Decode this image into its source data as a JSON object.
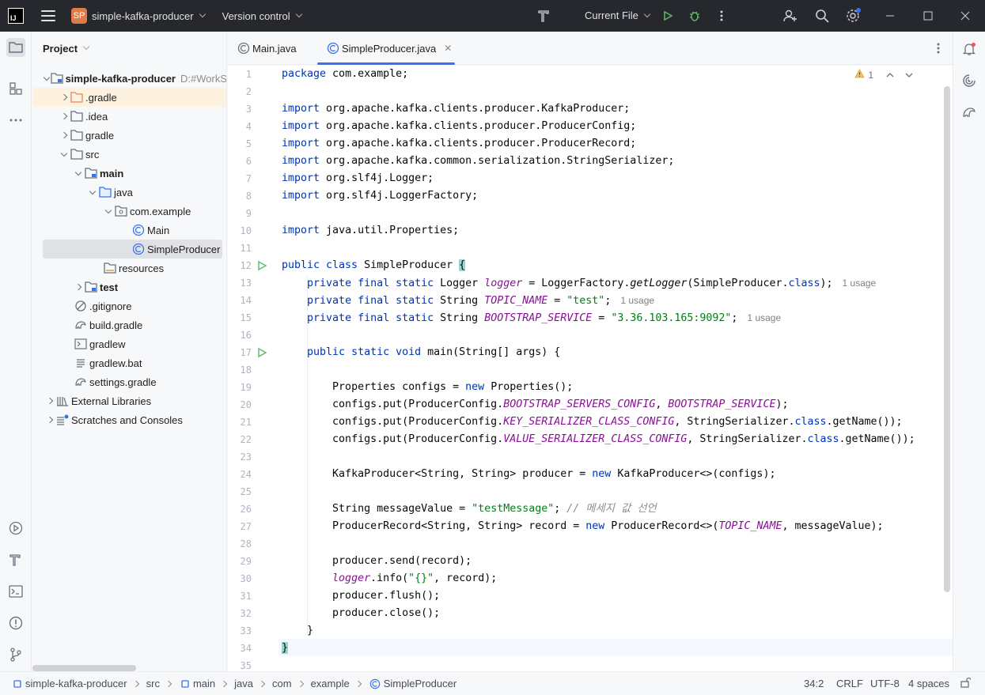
{
  "titlebar": {
    "app_logo": "IJ",
    "project_badge": "SP",
    "project_name": "simple-kafka-producer",
    "vcs_label": "Version control",
    "run_config": "Current File"
  },
  "project_panel": {
    "title": "Project",
    "root_name": "simple-kafka-producer",
    "root_path": "D:#WorkS",
    "items": [
      {
        "label": ".gradle"
      },
      {
        "label": ".idea"
      },
      {
        "label": "gradle"
      },
      {
        "label": "src"
      },
      {
        "label": "main"
      },
      {
        "label": "java"
      },
      {
        "label": "com.example"
      },
      {
        "label": "Main"
      },
      {
        "label": "SimpleProducer"
      },
      {
        "label": "resources"
      },
      {
        "label": "test"
      },
      {
        "label": ".gitignore"
      },
      {
        "label": "build.gradle"
      },
      {
        "label": "gradlew"
      },
      {
        "label": "gradlew.bat"
      },
      {
        "label": "settings.gradle"
      },
      {
        "label": "External Libraries"
      },
      {
        "label": "Scratches and Consoles"
      }
    ]
  },
  "tabs": [
    {
      "label": "Main.java"
    },
    {
      "label": "SimpleProducer.java"
    }
  ],
  "editor": {
    "warnings_count": "1",
    "usage_label": "1 usage",
    "line_numbers": [
      "1",
      "2",
      "3",
      "4",
      "5",
      "6",
      "7",
      "8",
      "9",
      "10",
      "11",
      "12",
      "13",
      "14",
      "15",
      "16",
      "17",
      "18",
      "19",
      "20",
      "21",
      "22",
      "23",
      "24",
      "25",
      "26",
      "27",
      "28",
      "29",
      "30",
      "31",
      "32",
      "33",
      "34",
      "35"
    ],
    "code": {
      "l1_kw": "package",
      "l1_rest": " com.example;",
      "imp": "import",
      "l3": " org.apache.kafka.clients.producer.KafkaProducer;",
      "l4": " org.apache.kafka.clients.producer.ProducerConfig;",
      "l5": " org.apache.kafka.clients.producer.ProducerRecord;",
      "l6": " org.apache.kafka.common.serialization.StringSerializer;",
      "l7": " org.slf4j.Logger;",
      "l8": " org.slf4j.LoggerFactory;",
      "l10": " java.util.Properties;",
      "l12_kw": "public class",
      "l12_name": " SimpleProducer ",
      "l12_brace": "{",
      "pfs": "private final static",
      "l13_type": " Logger ",
      "l13_var": "logger",
      "l13_mid": " = LoggerFactory.",
      "l13_method": "getLogger",
      "l13_arg": "(SimpleProducer.",
      "l13_class": "class",
      "l13_end": ");",
      "l14_type": " String ",
      "l14_var": "TOPIC_NAME",
      "l14_eq": " = ",
      "l14_str": "\"test\"",
      "l14_end": ";",
      "l15_type": " String ",
      "l15_var": "BOOTSTRAP_SERVICE",
      "l15_eq": " = ",
      "l15_str": "\"3.36.103.165:9092\"",
      "l15_end": ";",
      "l17_kw": "public static void",
      "l17_rest": " main(String[] args) {",
      "l19_a": "Properties configs = ",
      "l19_new": "new",
      "l19_b": " Properties();",
      "put_a": "configs.put(ProducerConfig.",
      "l20_c": "BOOTSTRAP_SERVERS_CONFIG",
      "l20_b": ", ",
      "l20_c2": "BOOTSTRAP_SERVICE",
      "l20_end": ");",
      "l21_c": "KEY_SERIALIZER_CLASS_CONFIG",
      "l21_b": ", StringSerializer.",
      "l21_kw": "class",
      "l21_end": ".getName());",
      "l22_c": "VALUE_SERIALIZER_CLASS_CONFIG",
      "l22_b": ", StringSerializer.",
      "l22_kw": "class",
      "l22_end": ".getName());",
      "l24_a": "KafkaProducer<String, String> producer = ",
      "l24_new": "new",
      "l24_b": " KafkaProducer<>(configs);",
      "l26_a": "String messageValue = ",
      "l26_str": "\"testMessage\"",
      "l26_b": "; ",
      "l26_cmt": "// 메세지 값 선언",
      "l27_a": "ProducerRecord<String, String> record = ",
      "l27_new": "new",
      "l27_b": " ProducerRecord<>(",
      "l27_c": "TOPIC_NAME",
      "l27_end": ", messageValue);",
      "l29": "producer.send(record);",
      "l30_var": "logger",
      "l30_a": ".info(",
      "l30_str": "\"{}\"",
      "l30_b": ", record);",
      "l31": "producer.flush();",
      "l32": "producer.close();",
      "l33": "}",
      "l34": "}"
    }
  },
  "statusbar": {
    "breadcrumb": [
      "simple-kafka-producer",
      "src",
      "main",
      "java",
      "com",
      "example",
      "SimpleProducer"
    ],
    "position": "34:2",
    "line_sep": "CRLF",
    "encoding": "UTF-8",
    "indent": "4 spaces"
  },
  "colors": {
    "keyword": "#0033b3",
    "string": "#067d17",
    "constant": "#871094",
    "accent": "#3574f0",
    "badge": "#e07a49"
  }
}
